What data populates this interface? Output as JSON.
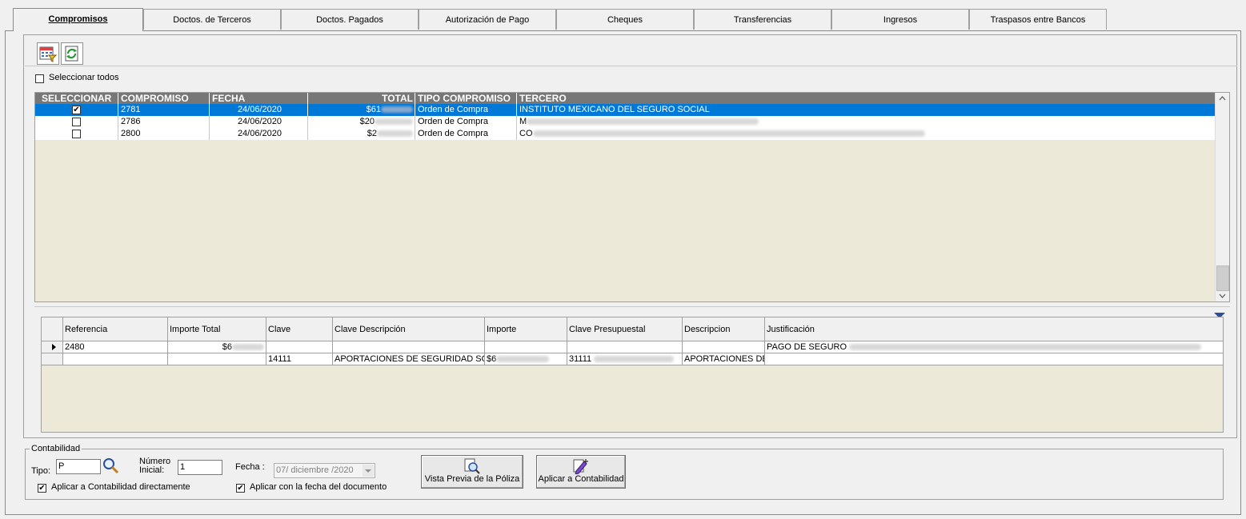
{
  "tabs": [
    {
      "label": "Compromisos",
      "active": true
    },
    {
      "label": "Doctos. de Terceros"
    },
    {
      "label": "Doctos. Pagados"
    },
    {
      "label": "Autorización de Pago"
    },
    {
      "label": "Cheques"
    },
    {
      "label": "Transferencias"
    },
    {
      "label": "Ingresos"
    },
    {
      "label": "Traspasos entre Bancos"
    }
  ],
  "toolbar": {
    "icons": [
      "calendar-filter-icon",
      "refresh-icon"
    ]
  },
  "select_all_label": "Seleccionar todos",
  "grid1": {
    "headers": [
      "SELECCIONAR",
      "COMPROMISO",
      "FECHA",
      "TOTAL",
      "TIPO COMPROMISO",
      "TERCERO"
    ],
    "rows": [
      {
        "checked": true,
        "compromiso": "2781",
        "fecha": "24/06/2020",
        "total": "$61",
        "tipo": "Orden de Compra",
        "tercero": "INSTITUTO MEXICANO DEL SEGURO SOCIAL",
        "selected": true
      },
      {
        "checked": false,
        "compromiso": "2786",
        "fecha": "24/06/2020",
        "total": "$20",
        "tipo": "Orden de Compra",
        "tercero": "M"
      },
      {
        "checked": false,
        "compromiso": "2800",
        "fecha": "24/06/2020",
        "total": "$2",
        "tipo": "Orden de Compra",
        "tercero": "CO"
      }
    ]
  },
  "grid2": {
    "headers": [
      "Referencia",
      "Importe Total",
      "Clave",
      "Clave Descripción",
      "Importe",
      "Clave Presupuestal",
      "Descripcion",
      "Justificación"
    ],
    "rows": [
      {
        "referencia": "2480",
        "importe_total": "$6",
        "clave": "",
        "clave_desc": "",
        "importe": "",
        "clave_pres": "",
        "descripcion": "",
        "justificacion": "PAGO DE SEGURO"
      },
      {
        "referencia": "",
        "importe_total": "",
        "clave": "14111",
        "clave_desc": "APORTACIONES DE SEGURIDAD SO",
        "importe": "$6",
        "clave_pres": "31111",
        "descripcion": "APORTACIONES DE",
        "justificacion": ""
      }
    ]
  },
  "contabilidad": {
    "title": "Contabilidad",
    "tipo_label": "Tipo:",
    "tipo_value": "P",
    "numero_label_1": "Número",
    "numero_label_2": "Inicial:",
    "numero_value": "1",
    "fecha_label": "Fecha :",
    "fecha_value": "07/ diciembre /2020",
    "aplicar_directo_label": "Aplicar a Contabilidad directamente",
    "aplicar_directo_checked": true,
    "aplicar_fecha_label": "Aplicar con la fecha del documento",
    "aplicar_fecha_checked": true,
    "preview_button": "Vista Previa de la Póliza",
    "apply_button": "Aplicar a Contabilidad"
  }
}
